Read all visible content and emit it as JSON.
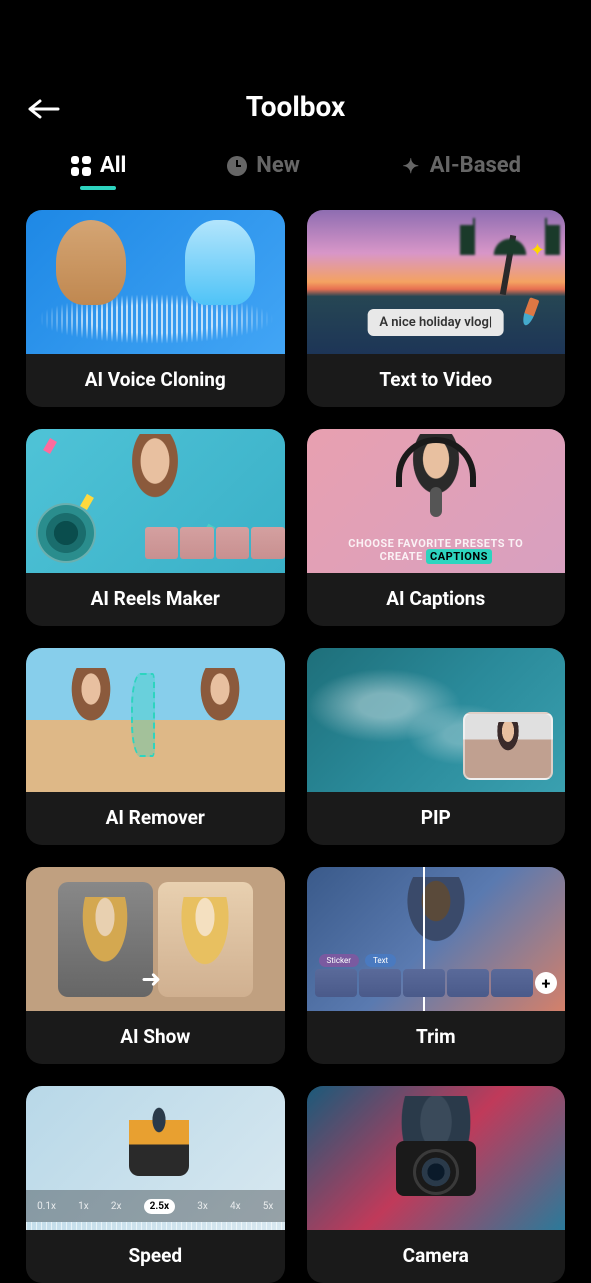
{
  "header": {
    "title": "Toolbox"
  },
  "tabs": [
    {
      "id": "all",
      "label": "All",
      "active": true
    },
    {
      "id": "new",
      "label": "New",
      "active": false
    },
    {
      "id": "ai",
      "label": "AI-Based",
      "active": false
    }
  ],
  "tools": [
    {
      "id": "ai-voice-cloning",
      "label": "AI Voice Cloning"
    },
    {
      "id": "text-to-video",
      "label": "Text  to Video",
      "thumb_text": "A nice holiday vlog|"
    },
    {
      "id": "ai-reels-maker",
      "label": "AI Reels Maker"
    },
    {
      "id": "ai-captions",
      "label": "AI Captions",
      "thumb_text_line1": "CHOOSE  FAVORITE PRESETS TO",
      "thumb_text_line2": "CREATE",
      "thumb_highlight": "CAPTIONS"
    },
    {
      "id": "ai-remover",
      "label": "AI Remover"
    },
    {
      "id": "pip",
      "label": "PIP"
    },
    {
      "id": "ai-show",
      "label": "AI Show"
    },
    {
      "id": "trim",
      "label": "Trim",
      "chip1": "Sticker",
      "chip2": "Text"
    },
    {
      "id": "speed",
      "label": "Speed",
      "marks": [
        "0.1x",
        "1x",
        "2x",
        "2.5x",
        "3x",
        "4x",
        "5x"
      ],
      "active_mark": "2.5x"
    },
    {
      "id": "camera",
      "label": "Camera"
    }
  ]
}
